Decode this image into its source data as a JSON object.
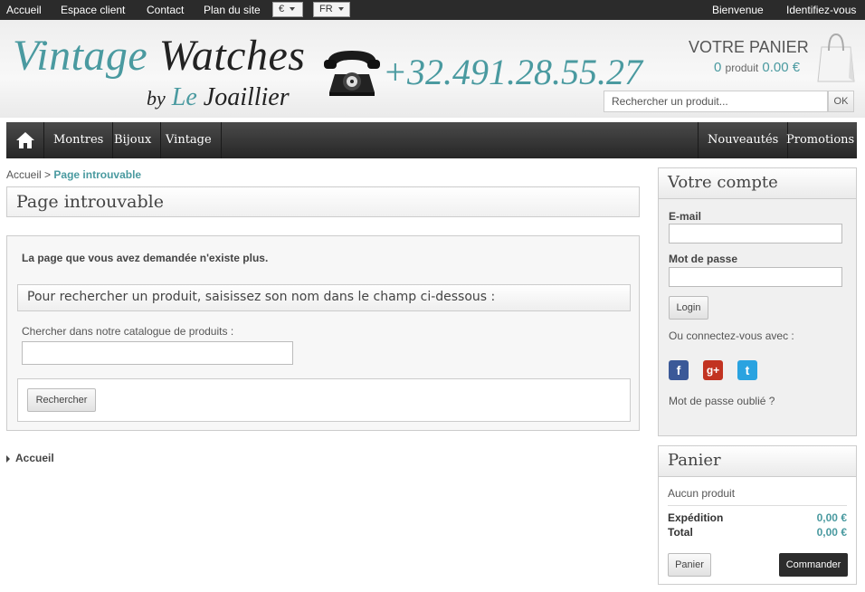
{
  "topbar": {
    "links": [
      "Accueil",
      "Espace client",
      "Contact",
      "Plan du site"
    ],
    "currency": "€",
    "language": "FR",
    "welcome": "Bienvenue",
    "login": "Identifiez-vous"
  },
  "header": {
    "logo_word1": "Vintage",
    "logo_word2": "Watches",
    "logo_by": "by",
    "logo_le": "Le",
    "logo_joaillier": "Joaillier",
    "phone": "+32.491.28.55.27",
    "cart_title": "VOTRE PANIER",
    "cart_count": "0",
    "cart_count_label": "produit",
    "cart_total": "0.00 €",
    "search_placeholder": "Rechercher un produit...",
    "search_button": "OK"
  },
  "nav": {
    "items": [
      "Montres",
      "Bijoux",
      "Vintage"
    ],
    "right_items": [
      "Nouveautés",
      "Promotions"
    ]
  },
  "breadcrumb": {
    "home": "Accueil",
    "separator": ">",
    "current": "Page introuvable"
  },
  "main": {
    "title": "Page introuvable",
    "message": "La page que vous avez demandée n'existe plus.",
    "subtitle": "Pour rechercher un produit, saisissez son nom dans le champ ci-dessous :",
    "field_label": "Chercher dans notre catalogue de produits :",
    "search_button": "Rechercher",
    "footer_link": "Accueil"
  },
  "account": {
    "title": "Votre compte",
    "email_label": "E-mail",
    "password_label": "Mot de passe",
    "login_button": "Login",
    "connect_with": "Ou connectez-vous avec :",
    "social": [
      "f",
      "g+",
      "t"
    ],
    "forgot": "Mot de passe oublié ?"
  },
  "cart": {
    "title": "Panier",
    "empty": "Aucun produit",
    "shipping_label": "Expédition",
    "shipping_value": "0,00 €",
    "total_label": "Total",
    "total_value": "0,00 €",
    "cart_button": "Panier",
    "order_button": "Commander"
  },
  "colors": {
    "accent": "#4a9aa0",
    "dark": "#2b2b2b",
    "facebook": "#3b5998",
    "google": "#c23321",
    "twitter": "#2aa3e0"
  }
}
